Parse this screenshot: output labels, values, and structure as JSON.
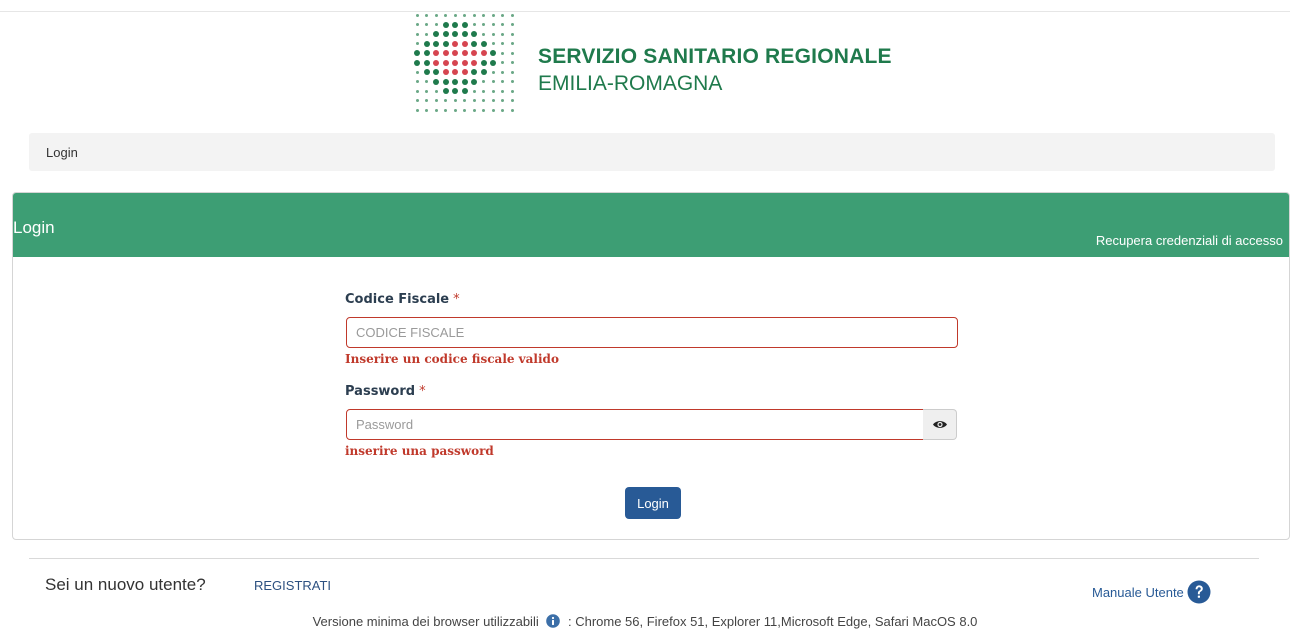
{
  "header": {
    "logo_title": "SERVIZIO SANITARIO REGIONALE",
    "logo_subtitle": "EMILIA-ROMAGNA",
    "brand_green": "#1f7a4c",
    "brand_red": "#d64550"
  },
  "breadcrumb": {
    "current": "Login"
  },
  "panel": {
    "title": "Login",
    "recover_link": "Recupera credenziali di accesso",
    "header_color": "#3d9e74"
  },
  "form": {
    "codice_fiscale": {
      "label": "Codice Fiscale",
      "required_mark": "*",
      "placeholder": "CODICE FISCALE",
      "value": "",
      "error": "Inserire un codice fiscale valido"
    },
    "password": {
      "label": "Password",
      "required_mark": "*",
      "placeholder": "Password",
      "value": "",
      "error": "inserire una password",
      "toggle_icon": "eye-icon"
    },
    "submit_label": "Login",
    "error_color": "#c0392b",
    "button_color": "#285a96"
  },
  "footer": {
    "new_user_text": "Sei un nuovo utente?",
    "register_link": "REGISTRATI",
    "manual_label": "Manuale Utente",
    "manual_icon": "question-circle-icon",
    "browsers_prefix": "Versione minima dei browser utilizzabili",
    "browsers_info_icon": "info-circle-icon",
    "browsers_list": ": Chrome 56, Firefox 51, Explorer 11,Microsoft Edge, Safari MacOS 8.0"
  }
}
